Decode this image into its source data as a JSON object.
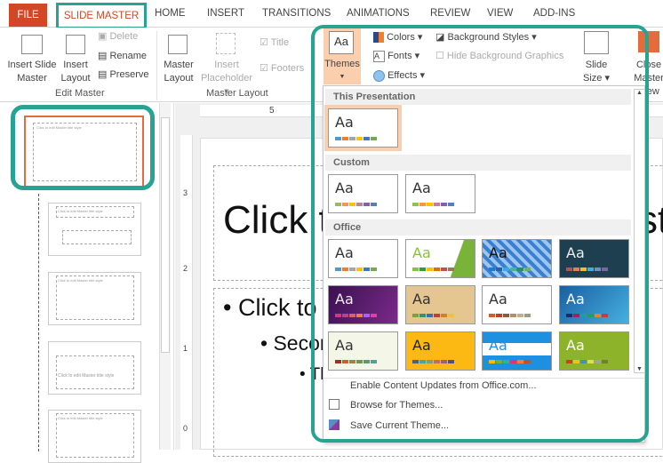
{
  "tabs": [
    "FILE",
    "SLIDE MASTER",
    "HOME",
    "INSERT",
    "TRANSITIONS",
    "ANIMATIONS",
    "REVIEW",
    "VIEW",
    "ADD-INS"
  ],
  "ribbon": {
    "insert_slide_master": [
      "Insert Slide",
      "Master"
    ],
    "insert_layout": [
      "Insert",
      "Layout"
    ],
    "delete": "Delete",
    "rename": "Rename",
    "preserve": "Preserve",
    "edit_master_label": "Edit Master",
    "master_layout": [
      "Master",
      "Layout"
    ],
    "insert_placeholder": [
      "Insert",
      "Placeholder ▾"
    ],
    "title_cb": "Title",
    "footers_cb": "Footers",
    "master_layout_label": "Master Layout",
    "themes": "Themes",
    "colors": "Colors ▾",
    "fonts": "Fonts ▾",
    "effects": "Effects ▾",
    "background_styles": "Background Styles ▾",
    "hide_bg": "Hide Background Graphics",
    "slide_size": [
      "Slide",
      "Size ▾"
    ],
    "close_master": [
      "Close",
      "Master View"
    ]
  },
  "ruler": {
    "top": "5",
    "left": [
      "3",
      "2",
      "1",
      "0"
    ]
  },
  "slide": {
    "title": "Click to edit Master title style",
    "bullet1": "• Click to edit Master text styles",
    "bullet2": "• Second level",
    "bullet3": "• Third level"
  },
  "thumb_text": "Click to edit Master title style",
  "gallery": {
    "sections": [
      "This Presentation",
      "Custom",
      "Office"
    ],
    "aa": "Aa",
    "this_presentation": [
      {
        "bg": "#ffffff",
        "fg": "#333",
        "sw": [
          "#4a9bd0",
          "#ed7d31",
          "#a5a5a5",
          "#ffc000",
          "#4472c4",
          "#70ad47"
        ],
        "selected": true
      }
    ],
    "custom": [
      {
        "bg": "#ffffff",
        "fg": "#333",
        "sw": [
          "#9bbb59",
          "#f79646",
          "#ffc000",
          "#c0809d",
          "#8064a2",
          "#4f81bd"
        ]
      },
      {
        "bg": "#ffffff",
        "fg": "#333",
        "sw": [
          "#9bbb59",
          "#f79646",
          "#ffc000",
          "#c0809d",
          "#8064a2",
          "#4f81bd"
        ]
      }
    ],
    "office": [
      {
        "bg": "#ffffff",
        "fg": "#333",
        "sw": [
          "#4a9bd0",
          "#ed7d31",
          "#a5a5a5",
          "#ffc000",
          "#4472c4",
          "#70ad47"
        ]
      },
      {
        "bg": "linear-gradient(110deg,#fff 70%,#7ab33a 71%)",
        "fg": "#8cbf3f",
        "sw": [
          "#8cbf3f",
          "#2c9c3f",
          "#ffc000",
          "#e36c09",
          "#c0504d",
          "#8e7d5a"
        ]
      },
      {
        "bg": "repeating-linear-gradient(45deg,#3a7fd0 0 4px,#9cc5f0 4px 8px)",
        "fg": "#111",
        "sw": [
          "#1e7ad0",
          "#2a5fa8",
          "#3da8e0",
          "#3eb8a0",
          "#2a8f60",
          "#6fb070"
        ]
      },
      {
        "bg": "#1e3f4f",
        "fg": "#eee",
        "sw": [
          "#c0504d",
          "#f08030",
          "#f0c020",
          "#4bacc6",
          "#6f8fc0",
          "#8064a2"
        ]
      },
      {
        "bg": "linear-gradient(120deg,#3a1050,#7a2a8a)",
        "fg": "#eee",
        "sw": [
          "#e0307f",
          "#c04080",
          "#e06060",
          "#f08040",
          "#b060f0",
          "#e040a0"
        ]
      },
      {
        "bg": "#e6c690",
        "fg": "#333",
        "sw": [
          "#7aa33a",
          "#3a8f6f",
          "#3a6fb0",
          "#c04030",
          "#d08030",
          "#f0c040"
        ]
      },
      {
        "bg": "#ffffff",
        "fg": "#333",
        "sw": [
          "#d06020",
          "#c04020",
          "#8a5a40",
          "#b0906a",
          "#c0b090",
          "#90a080"
        ]
      },
      {
        "bg": "linear-gradient(135deg,#1a5fa0,#46b0e0)",
        "fg": "#fff",
        "sw": [
          "#1a2a6a",
          "#b01a5a",
          "#1aa0a0",
          "#2aa040",
          "#f08020",
          "#e03030"
        ]
      },
      {
        "bg": "#f4f6e8",
        "fg": "#333",
        "sw": [
          "#a03020",
          "#d06020",
          "#a08050",
          "#6a9a40",
          "#5a9a70",
          "#50a0a0"
        ]
      },
      {
        "bg": "#fdb913",
        "fg": "#222",
        "sw": [
          "#5a5a7a",
          "#50a0a0",
          "#80a070",
          "#c07050",
          "#a06070",
          "#505080"
        ]
      },
      {
        "bg": "linear-gradient(#1e90e0 0 28%,#fff 28% 62%,#1e90e0 62%)",
        "fg": "#1e90e0",
        "sw": [
          "#f0c000",
          "#70b040",
          "#30b0a0",
          "#e0307f",
          "#f08030",
          "#c05030"
        ]
      },
      {
        "bg": "#8db32a",
        "fg": "#fff",
        "sw": [
          "#d04020",
          "#f0c020",
          "#4090c0",
          "#e0e040",
          "#a0a0a0",
          "#708030"
        ]
      }
    ]
  },
  "menu": {
    "enable_updates": "Enable Content Updates from Office.com...",
    "browse": "Browse for Themes...",
    "save": "Save Current Theme..."
  },
  "colors": {
    "accent": "#d24726",
    "highlight": "#27a391",
    "selected_theme": "#fbcfae"
  }
}
